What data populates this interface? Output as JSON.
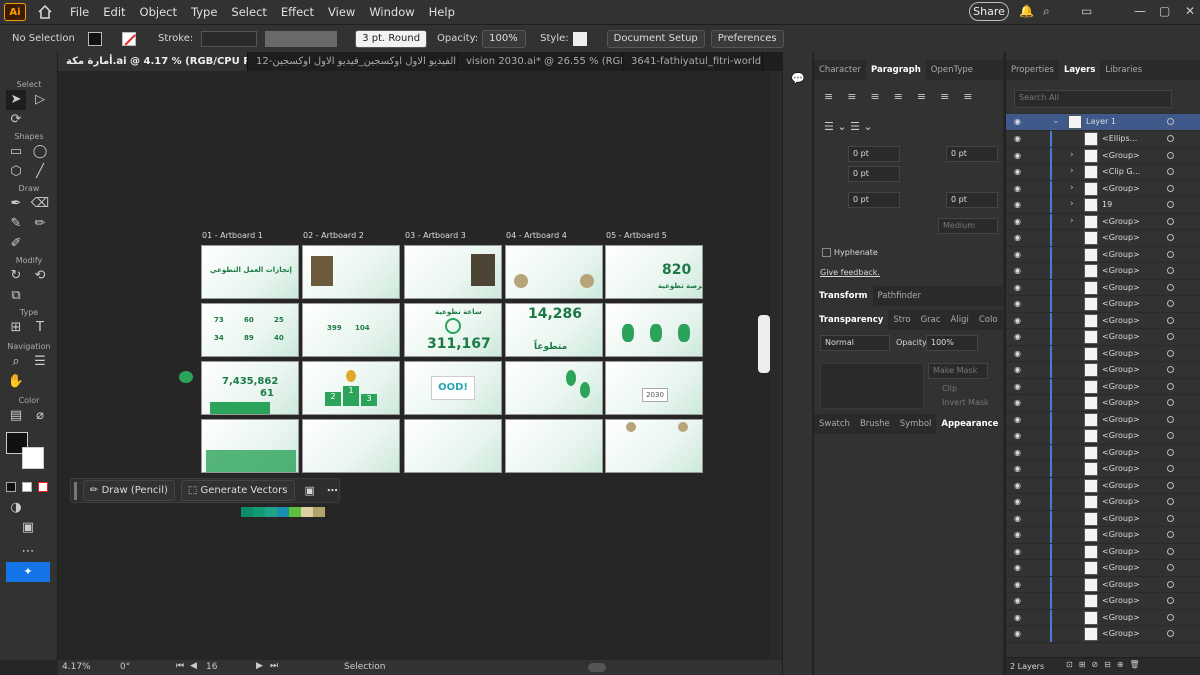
{
  "app": {
    "logo": "Ai",
    "menu": [
      "File",
      "Edit",
      "Object",
      "Type",
      "Select",
      "Effect",
      "View",
      "Window",
      "Help"
    ],
    "share_label": "Share"
  },
  "control": {
    "selection": "No Selection",
    "stroke_label": "Stroke:",
    "brush": "3 pt. Round",
    "opacity_label": "Opacity:",
    "opacity_value": "100%",
    "style_label": "Style:",
    "doc_setup": "Document Setup",
    "preferences": "Preferences"
  },
  "tabs": [
    "أمارة مكة.ai @ 4.17 % (RGB/CPU Preview)",
    "12-الفيديو الاول اوكسجين_فيديو الاول اوكسجين.ai*",
    "vision 2030.ai* @ 26.55 % (RGB/...",
    "3641-fathiyatul_fitri-world"
  ],
  "toolbar": {
    "select": "Select",
    "shapes": "Shapes",
    "draw": "Draw",
    "modify": "Modify",
    "type": "Type",
    "navigation": "Navigation",
    "color": "Color"
  },
  "artboards": {
    "labels": [
      "01 - Artboard 1",
      "02 - Artboard 2",
      "03 - Artboard 3",
      "04 - Artboard 4",
      "05 - Artboard 5"
    ],
    "texts": {
      "a1": "إنجازات العمل التطوعي",
      "big1": "820",
      "big1_sub": "فرصة تطوعية",
      "hours_title": "ساعة تطوعية",
      "hours": "311,167",
      "vol": "14,286",
      "vol_sub": "متطوعاً",
      "num1": "7,435,862",
      "num2": "61",
      "n399": "399",
      "n104": "104",
      "n73": "73",
      "n60": "60",
      "n25": "25",
      "n34": "34",
      "n89": "89",
      "n40": "40",
      "rank1": "1",
      "rank2": "2",
      "rank3": "3",
      "logo_text": "OOD!",
      "vision": "2030"
    }
  },
  "context": {
    "draw": "Draw (Pencil)",
    "generate": "Generate Vectors"
  },
  "status": {
    "zoom": "4.17%",
    "angle": "0°",
    "page": "16",
    "mode": "Selection"
  },
  "paragraph": {
    "tabs": [
      "Character",
      "Paragraph",
      "OpenType"
    ],
    "indent_values": [
      "0 pt",
      "0 pt",
      "0 pt",
      "0 pt",
      "0 pt"
    ],
    "medium": "Medium",
    "hyphenate": "Hyphenate",
    "feedback": "Give feedback.",
    "transform_tabs": [
      "Transform",
      "Pathfinder"
    ],
    "transparency_tabs": [
      "Transparency",
      "Stro",
      "Grac",
      "Aligi",
      "Colo"
    ],
    "blend": "Normal",
    "opacity_label": "Opacity:",
    "opacity_value": "100%",
    "make_mask": "Make Mask",
    "clip": "Clip",
    "invert": "Invert Mask",
    "swatch_tabs": [
      "Swatch",
      "Brushe",
      "Symbol",
      "Appearance"
    ]
  },
  "layers": {
    "tabs": [
      "Properties",
      "Layers",
      "Libraries"
    ],
    "search_placeholder": "Search All",
    "layer1": "Layer 1",
    "rows": [
      "<Ellips...",
      "<Group>",
      "<Clip G...",
      "<Group>",
      "19",
      "<Group>",
      "<Group>",
      "<Group>",
      "<Group>",
      "<Group>",
      "<Group>",
      "<Group>",
      "<Group>",
      "<Group>",
      "<Group>",
      "<Group>",
      "<Group>",
      "<Group>",
      "<Group>",
      "<Group>",
      "<Group>",
      "<Group>",
      "<Group>",
      "<Group>",
      "<Group>",
      "<Group>",
      "<Group>",
      "<Group>",
      "<Group>",
      "<Group>",
      "<Group>",
      "<Group>"
    ],
    "footer": "2 Layers"
  }
}
